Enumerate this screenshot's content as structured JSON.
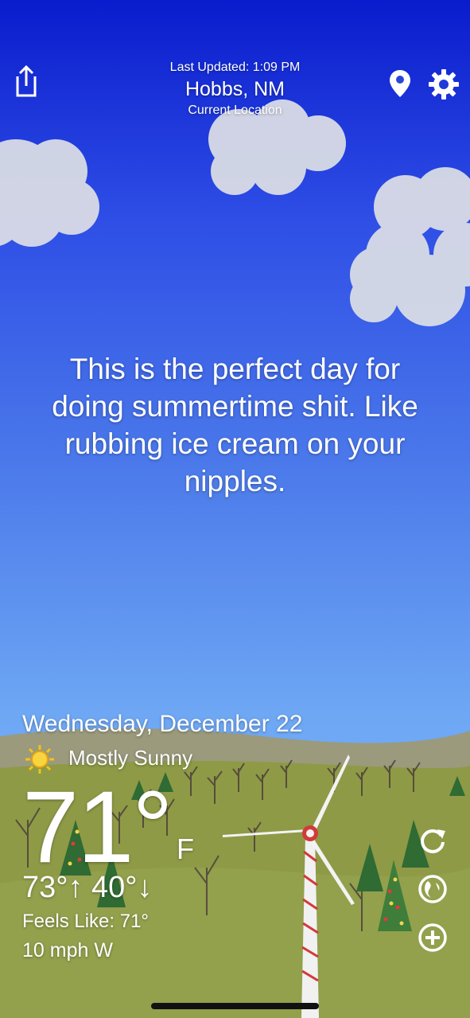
{
  "header": {
    "last_updated": "Last Updated: 1:09 PM",
    "city": "Hobbs, NM",
    "location_label": "Current Location"
  },
  "quote": "This is the perfect day for doing summertime shit. Like rubbing ice cream on your nipples.",
  "weather": {
    "date": "Wednesday, December 22",
    "condition": "Mostly Sunny",
    "temperature": "71°",
    "unit": "F",
    "hi_lo": "73°↑ 40°↓",
    "feels_like": "Feels Like: 71°",
    "wind": "10 mph W"
  },
  "icons": {
    "share": "share-icon",
    "location": "location-pin-icon",
    "settings": "gear-icon",
    "refresh": "refresh-icon",
    "radar": "radar-icon",
    "add": "add-icon",
    "condition": "sun-icon"
  },
  "colors": {
    "sky_top": "#0a1ccd",
    "sky_bottom": "#7db8f6",
    "hills": "#8f9b45",
    "hills_far": "#9a9b75"
  }
}
